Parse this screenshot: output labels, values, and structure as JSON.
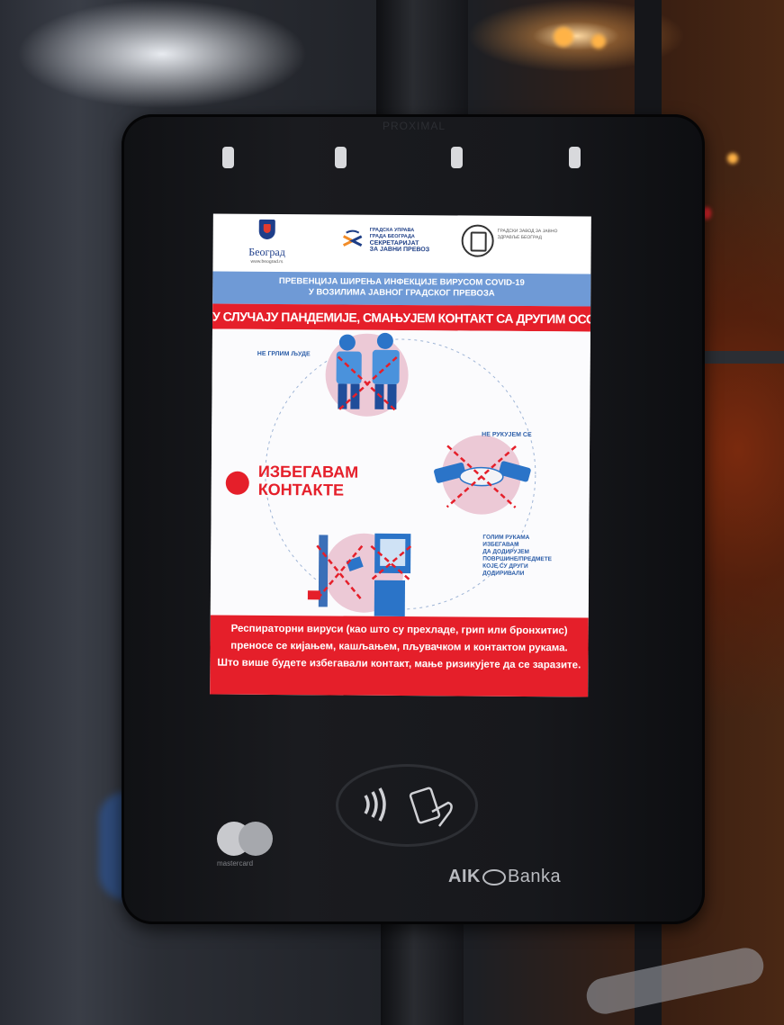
{
  "scene": {
    "device_top_stamp": "PROXIMAL"
  },
  "poster": {
    "logos": {
      "city_name": "Београд",
      "city_url": "www.beograd.rs",
      "secretariat_line1": "ГРАДСКА УПРАВА",
      "secretariat_line2": "ГРАДА БЕОГРАДА",
      "secretariat_line3": "СЕКРЕТАРИЈАТ",
      "secretariat_line4": "ЗА ЈАВНИ ПРЕВОЗ",
      "institute_text": "ГРАДСКИ ЗАВОД ЗА ЈАВНО ЗДРАВЉЕ БЕОГРАД"
    },
    "header_line1": "ПРЕВЕНЦИЈА ШИРЕЊА ИНФЕКЦИЈЕ ВИРУСОМ COVID-19",
    "header_line2": "У ВОЗИЛИМА ЈАВНОГ ГРАДСКОГ ПРЕВОЗА",
    "headline": "У СЛУЧАЈУ ПАНДЕМИЈЕ, СМАЊУЈЕМ КОНТАКТ СА ДРУГИМ ОСОБАМА",
    "label_hug": "НЕ ГРЛИМ ЉУДЕ",
    "label_handshake": "НЕ РУКУЈЕМ СЕ",
    "avoid_line1": "ИЗБЕГАВАМ",
    "avoid_line2": "КОНТАКТЕ",
    "label_surfaces_1": "ГОЛИМ РУКАМА",
    "label_surfaces_2": "ИЗБЕГАВАМ",
    "label_surfaces_3": "ДА ДОДИРУЈЕМ",
    "label_surfaces_4": "ПОВРШИНЕ/ПРЕДМЕТЕ",
    "label_surfaces_5": "КОЈЕ СУ ДРУГИ",
    "label_surfaces_6": "ДОДИРИВАЛИ",
    "footer_line1": "Респираторни вируси (као што су прехладе, грип или бронхитис)",
    "footer_line2": "преносе се кијањем, кашљањем, пљувачком и контактом рукама.",
    "footer_line3": "Што више будете избегавали контакт, мање ризикујете да се заразите."
  },
  "device": {
    "mastercard": "mastercard",
    "bank_bold": "AIK",
    "bank_rest": "Banka"
  },
  "colors": {
    "poster_red": "#e51f2a",
    "poster_blue": "#6f9ad6",
    "illustration_blue": "#2b74c8",
    "illustration_pink": "#e9c3d2"
  }
}
